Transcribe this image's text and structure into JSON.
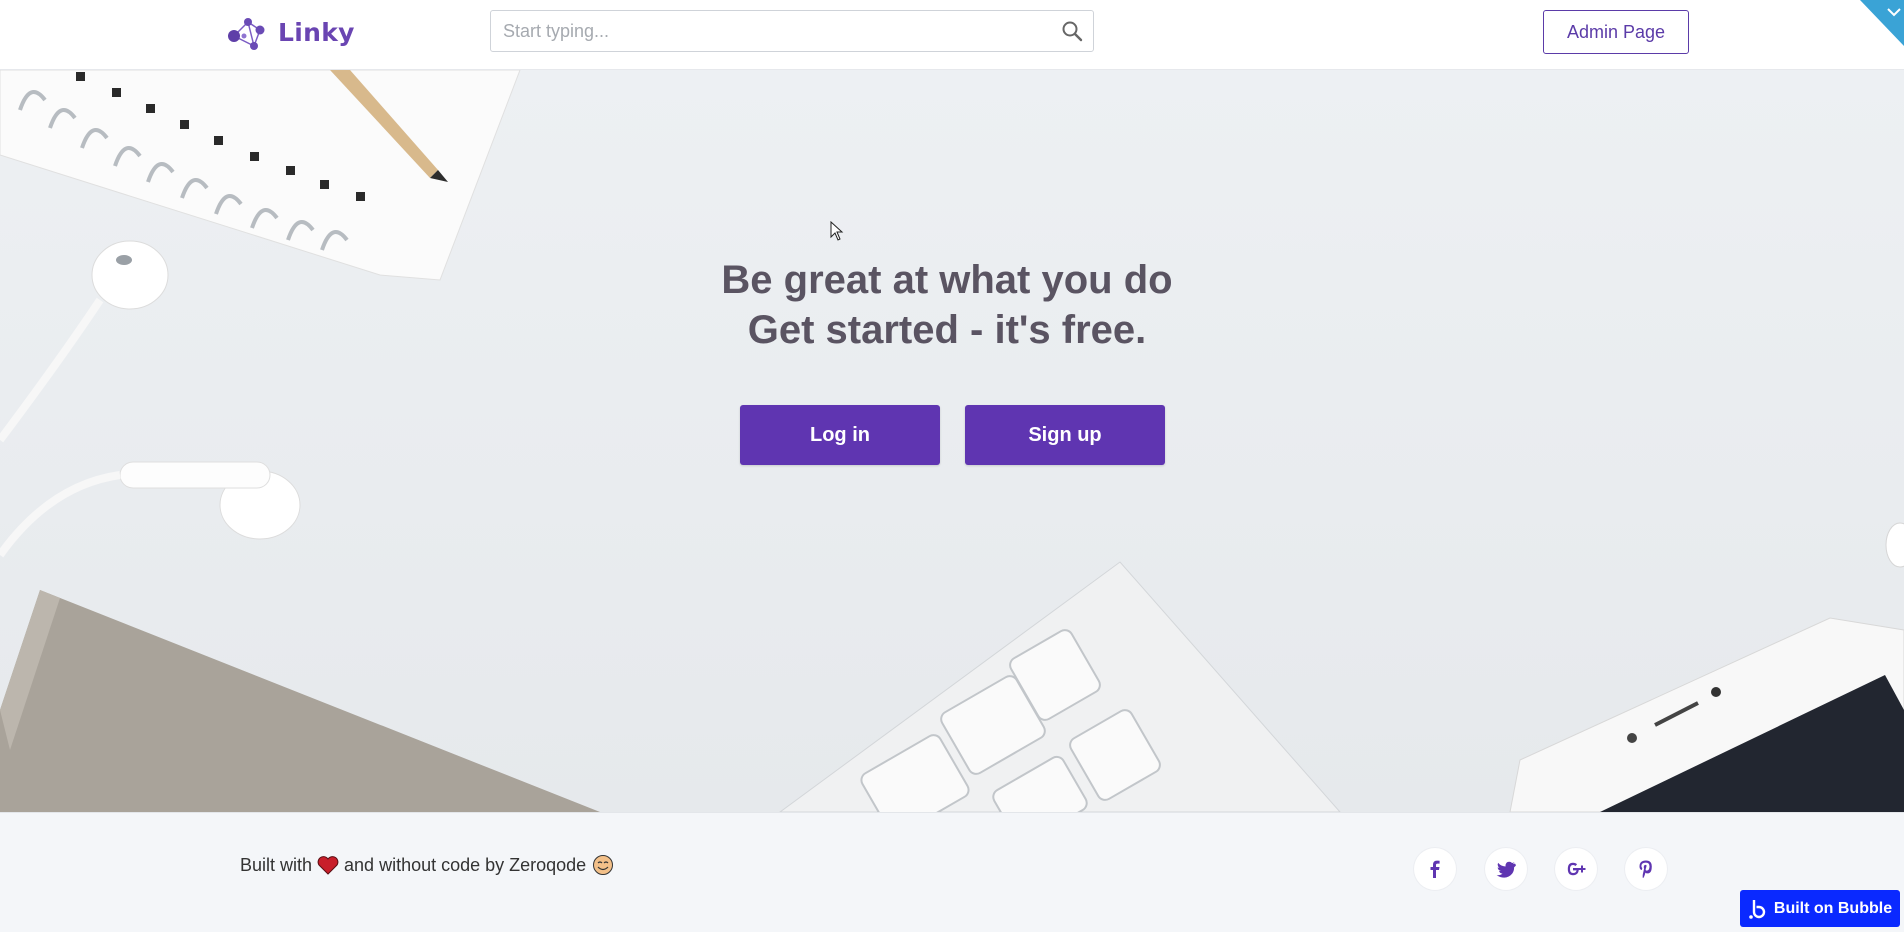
{
  "header": {
    "logo_text": "Linky",
    "search": {
      "placeholder": "Start typing..."
    },
    "admin_button": "Admin Page"
  },
  "hero": {
    "headline_line1": "Be great at what you do",
    "headline_line2": "Get started - it's free.",
    "login_button": "Log in",
    "signup_button": "Sign up"
  },
  "footer": {
    "built_with": "Built with",
    "without_code": "and without code by Zeroqode",
    "social": [
      "facebook-icon",
      "twitter-icon",
      "google-plus-icon",
      "pinterest-icon"
    ],
    "badge": "Built on Bubble"
  },
  "colors": {
    "brand": "#5f35b1",
    "accent_outline": "#5b3ba8",
    "badge": "#0a29ff",
    "corner_tab": "#3aa3d6"
  }
}
